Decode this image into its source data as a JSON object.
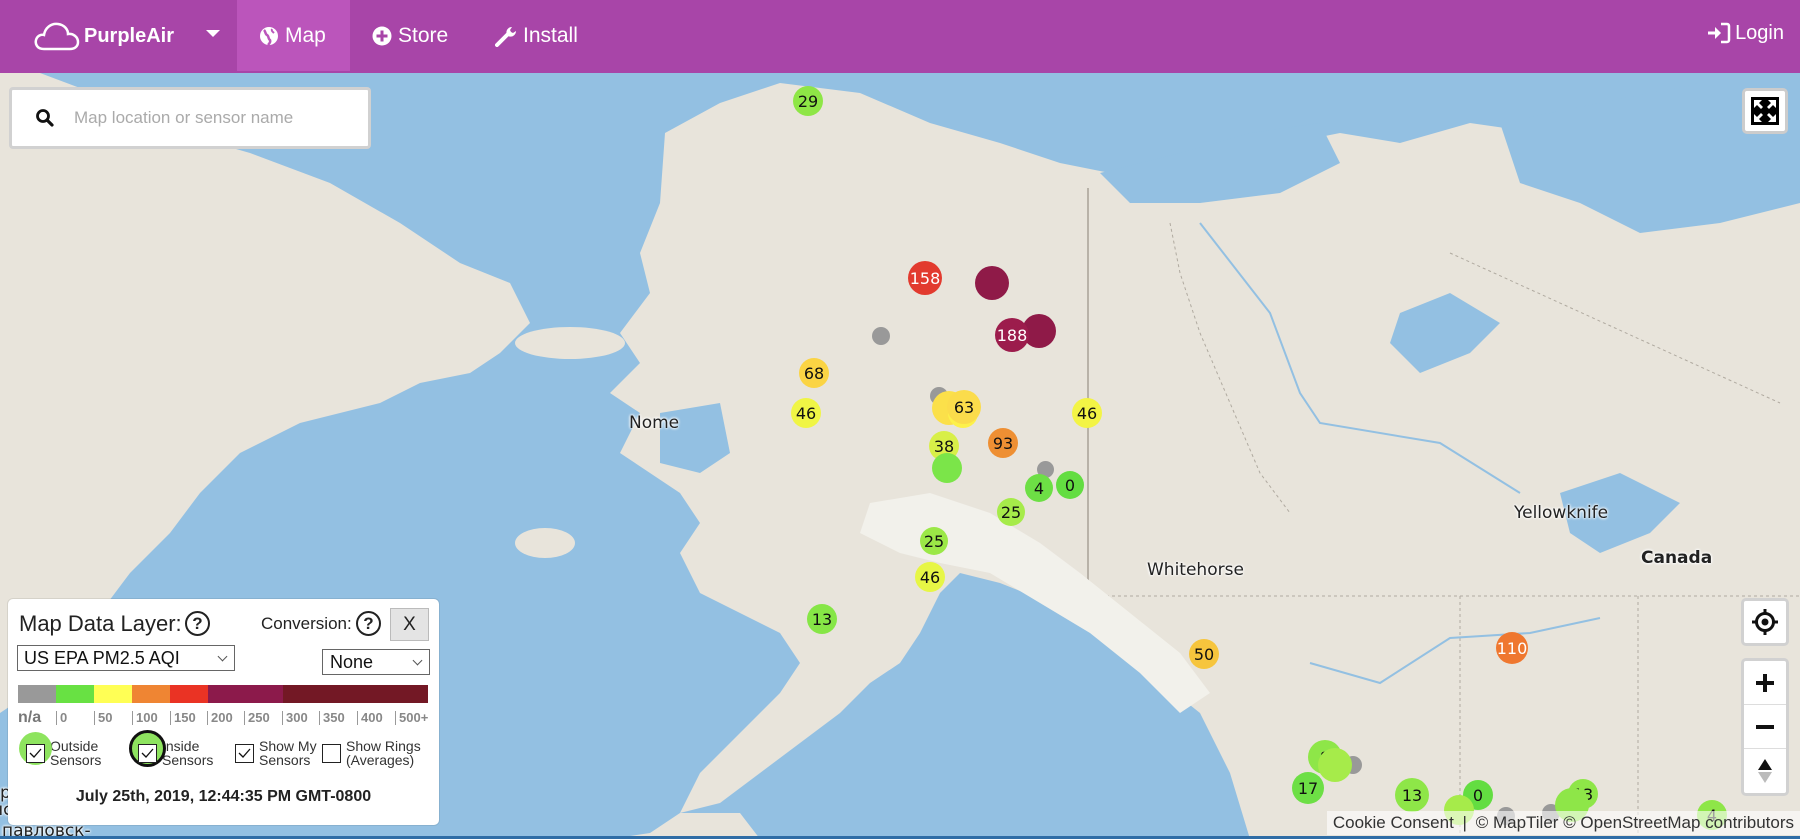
{
  "navbar": {
    "brand": "PurpleAir",
    "items": [
      {
        "label": "Map",
        "icon": "globe-icon",
        "active": true
      },
      {
        "label": "Store",
        "icon": "plus-circle-icon",
        "active": false
      },
      {
        "label": "Install",
        "icon": "wrench-icon",
        "active": false
      }
    ],
    "login": "Login"
  },
  "search": {
    "placeholder": "Map location or sensor name",
    "value": ""
  },
  "legend": {
    "title": "Map Data Layer:",
    "help": "?",
    "conversion_label": "Conversion:",
    "close_label": "X",
    "data_layer_selected": "US EPA PM2.5 AQI",
    "conversion_selected": "None",
    "scale_colors": [
      "#999999",
      "#68e143",
      "#ffff55",
      "#ef8533",
      "#ea3324",
      "#8c1a4b",
      "#731825"
    ],
    "scale_labels": [
      "n/a",
      "0",
      "50",
      "100",
      "150",
      "200",
      "250",
      "300",
      "350",
      "400",
      "500+"
    ],
    "checkboxes": [
      {
        "label_line1": "Outside",
        "label_line2": "Sensors",
        "checked": true
      },
      {
        "label_line1": "Inside",
        "label_line2": "Sensors",
        "checked": true
      },
      {
        "label_line1": "Show My",
        "label_line2": "Sensors",
        "checked": true
      },
      {
        "label_line1": "Show Rings",
        "label_line2": "(Averages)",
        "checked": false
      }
    ],
    "timestamp": "July 25th, 2019, 12:44:35 PM GMT-0800"
  },
  "map": {
    "labels": [
      {
        "text": "Nome",
        "bold": false
      },
      {
        "text": "Whitehorse",
        "bold": false
      },
      {
        "text": "Yellowknife",
        "bold": false
      },
      {
        "text": "Canada",
        "bold": true
      },
      {
        "text": "р",
        "bold": false
      },
      {
        "text": "нс",
        "bold": false
      },
      {
        "text": "павловск-",
        "bold": false
      }
    ],
    "sensors": [
      {
        "value": "29",
        "color": "#8ee646"
      },
      {
        "value": "158",
        "color": "#e23a2e"
      },
      {
        "value": "",
        "color": "#8f1a48"
      },
      {
        "value": "",
        "color": "#8f1a48"
      },
      {
        "value": "188",
        "color": "#9c1c4c"
      },
      {
        "value": "",
        "color": "#999999"
      },
      {
        "value": "68",
        "color": "#fbd444"
      },
      {
        "value": "46",
        "color": "#f0f545"
      },
      {
        "value": "",
        "color": "#999999"
      },
      {
        "value": "",
        "color": "#fbe04a"
      },
      {
        "value": "",
        "color": "#fdf14a"
      },
      {
        "value": "63",
        "color": "#fbdc4b"
      },
      {
        "value": "46",
        "color": "#f3f445"
      },
      {
        "value": "93",
        "color": "#ee8f33"
      },
      {
        "value": "38",
        "color": "#d8ef48"
      },
      {
        "value": "",
        "color": "#7be549"
      },
      {
        "value": "",
        "color": "#999999"
      },
      {
        "value": "4",
        "color": "#6ddf45"
      },
      {
        "value": "0",
        "color": "#63dd41"
      },
      {
        "value": "25",
        "color": "#a6eb4a"
      },
      {
        "value": "25",
        "color": "#9be847"
      },
      {
        "value": "46",
        "color": "#e7f645"
      },
      {
        "value": "13",
        "color": "#86e646"
      },
      {
        "value": "50",
        "color": "#f6c53d"
      },
      {
        "value": "110",
        "color": "#ef772f"
      },
      {
        "value": "8",
        "color": "#8ee648"
      },
      {
        "value": "",
        "color": "#a6eb4a"
      },
      {
        "value": "",
        "color": "#999999"
      },
      {
        "value": "17",
        "color": "#6ddf45"
      },
      {
        "value": "13",
        "color": "#8ee648"
      },
      {
        "value": "0",
        "color": "#63dd41"
      },
      {
        "value": "",
        "color": "#a6eb4a"
      },
      {
        "value": "",
        "color": "#999999"
      },
      {
        "value": "",
        "color": "#999999"
      },
      {
        "value": "13",
        "color": "#8ee648"
      },
      {
        "value": "",
        "color": "#8ee648"
      },
      {
        "value": "4",
        "color": "#8ee648"
      }
    ]
  },
  "attribution": {
    "cookie": "Cookie Consent",
    "separator": "|",
    "maptiler": "© MapTiler",
    "osm": "© OpenStreetMap contributors"
  }
}
